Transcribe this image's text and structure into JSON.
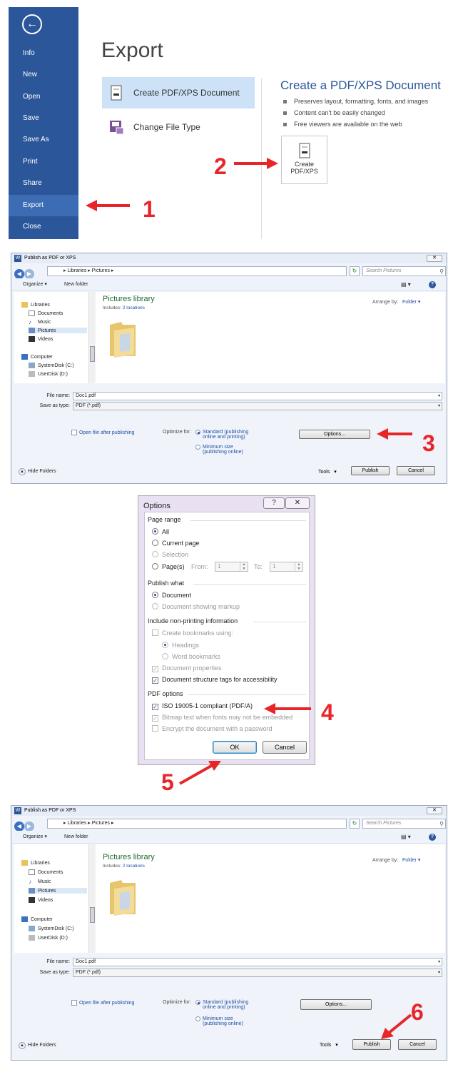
{
  "backstage": {
    "back_label": "←",
    "menu": [
      "Info",
      "New",
      "Open",
      "Save",
      "Save As",
      "Print",
      "Share",
      "Export",
      "Close"
    ],
    "active_item": "Export",
    "title": "Export",
    "options": [
      {
        "label": "Create PDF/XPS Document",
        "icon": "pdf-doc-icon",
        "selected": true
      },
      {
        "label": "Change File Type",
        "icon": "file-type-icon",
        "selected": false
      }
    ],
    "panel_title": "Create a PDF/XPS Document",
    "bullets": [
      "Preserves layout, formatting, fonts, and images",
      "Content can't be easily changed",
      "Free viewers are available on the web"
    ],
    "create_button_line1": "Create",
    "create_button_line2": "PDF/XPS"
  },
  "steps": {
    "s1": "1",
    "s2": "2",
    "s3": "3",
    "s4": "4",
    "s5": "5",
    "s6": "6"
  },
  "publish_dialog": {
    "title": "Publish as PDF or XPS",
    "close": "✕",
    "path_parts": [
      "Libraries",
      "Pictures"
    ],
    "path_sep": "▸",
    "search_placeholder": "Search Pictures",
    "organize": "Organize ▾",
    "new_folder": "New folder",
    "view_icon": "▤ ▾",
    "help": "?",
    "tree": [
      "Libraries",
      "Documents",
      "Music",
      "Pictures",
      "Videos",
      "Computer",
      "SystemDisk (C:)",
      "UserDisk (D:)"
    ],
    "tree_selected": "Pictures",
    "library_title": "Pictures library",
    "includes_label": "Includes:",
    "includes_value": "2 locations",
    "arrange_label": "Arrange by:",
    "arrange_value": "Folder ▾",
    "file_name_label": "File name:",
    "file_name_value": "Doc1.pdf",
    "save_type_label": "Save as type:",
    "save_type_value": "PDF (*.pdf)",
    "open_after": "Open file after publishing",
    "optimize_label": "Optimize for:",
    "opt_standard_1": "Standard (publishing",
    "opt_standard_2": "online and printing)",
    "opt_min_1": "Minimum size",
    "opt_min_2": "(publishing online)",
    "options_button": "Options...",
    "hide_folders": "Hide Folders",
    "tools": "Tools",
    "tools_arrow": "▾",
    "publish_button": "Publish",
    "cancel_button": "Cancel"
  },
  "options_dialog": {
    "title": "Options",
    "help": "?",
    "close": "✕",
    "page_range": "Page range",
    "all": "All",
    "current_page": "Current page",
    "selection": "Selection",
    "pages": "Page(s)",
    "from_label": "From:",
    "from_value": "1",
    "to_label": "To:",
    "to_value": "1",
    "publish_what": "Publish what",
    "document": "Document",
    "document_markup": "Document showing markup",
    "include_nonprint": "Include non-printing information",
    "create_bookmarks": "Create bookmarks using:",
    "headings": "Headings",
    "word_bookmarks": "Word bookmarks",
    "doc_properties": "Document properties",
    "doc_structure": "Document structure tags for accessibility",
    "pdf_options": "PDF options",
    "iso": "ISO 19005-1 compliant (PDF/A)",
    "bitmap": "Bitmap text when fonts may not be embedded",
    "encrypt": "Encrypt the document with a password",
    "ok": "OK",
    "cancel": "Cancel",
    "check_mark": "✓"
  },
  "colors": {
    "brand_blue": "#2b579a",
    "arrow_red": "#e8262a",
    "library_green": "#1e6b2e",
    "link_blue": "#1f4ea3"
  }
}
